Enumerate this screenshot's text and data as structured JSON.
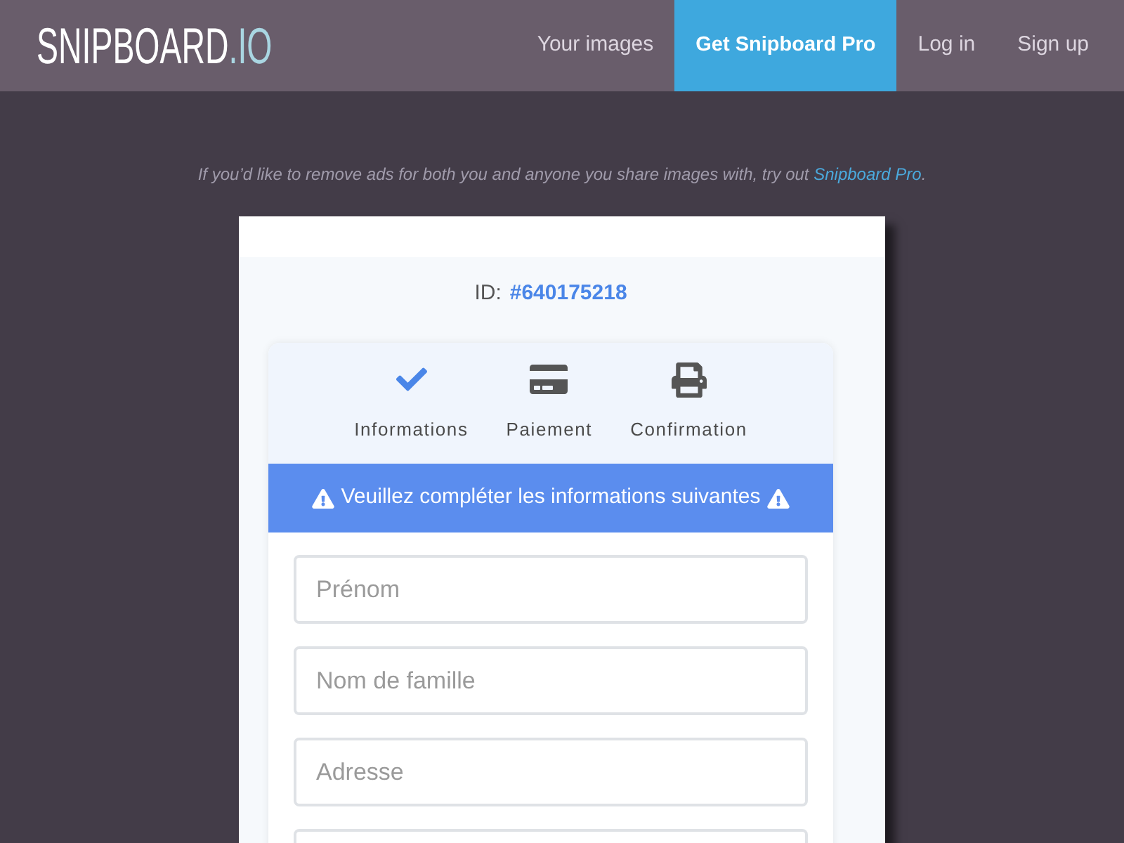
{
  "nav": {
    "logo": {
      "name": "SNIPBOARD",
      "suffix": ".IO"
    },
    "links": [
      {
        "label": "Your images",
        "highlighted": false
      },
      {
        "label": "Get Snipboard Pro",
        "highlighted": true
      },
      {
        "label": "Log in",
        "highlighted": false
      },
      {
        "label": "Sign up",
        "highlighted": false
      }
    ]
  },
  "ad_notice": {
    "text": "If you’d like to remove ads for both you and anyone you share images with, try out",
    "link": "Snipboard Pro",
    "end": "."
  },
  "screenshot": {
    "id_label": "ID:",
    "id_value": "#640175218",
    "steps": [
      {
        "kind": "check",
        "label": "Informations",
        "done": true
      },
      {
        "kind": "card",
        "label": "Paiement",
        "done": false
      },
      {
        "kind": "printer",
        "label": "Confirmation",
        "done": false
      }
    ],
    "banner": "Veuillez compléter les informations suivantes",
    "fields": [
      {
        "placeholder": "Prénom"
      },
      {
        "placeholder": "Nom de famille"
      },
      {
        "placeholder": "Adresse"
      }
    ],
    "more_fields_below": true
  }
}
